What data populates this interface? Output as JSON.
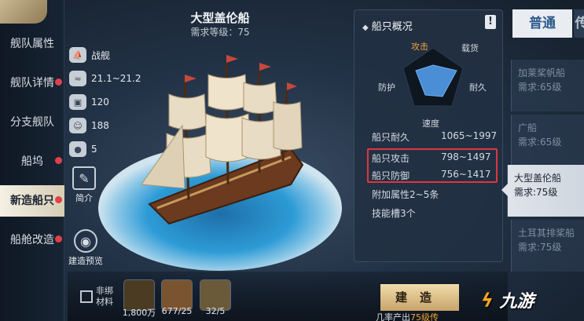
{
  "nav": {
    "items": [
      {
        "label": "舰队属性",
        "dot": false,
        "active": false
      },
      {
        "label": "舰队详情",
        "dot": true,
        "active": false
      },
      {
        "label": "分支舰队",
        "dot": false,
        "active": false
      },
      {
        "label": "船坞",
        "dot": true,
        "active": false
      },
      {
        "label": "新造船只",
        "dot": true,
        "active": true
      },
      {
        "label": "船舱改造",
        "dot": true,
        "active": false
      }
    ]
  },
  "ship": {
    "name": "大型盖伦船",
    "level_label": "需求等级：75",
    "stats": [
      {
        "icon": "ship-type-icon",
        "value": "战舰"
      },
      {
        "icon": "speed-icon",
        "value": "21.1~21.2"
      },
      {
        "icon": "cargo-icon",
        "value": "120"
      },
      {
        "icon": "crew-icon",
        "value": "188"
      },
      {
        "icon": "cannon-icon",
        "value": "5"
      }
    ],
    "intro_label": "简介",
    "preview_label": "建造预览"
  },
  "overview": {
    "title": "船只概况",
    "info_glyph": "!",
    "radar_labels": {
      "attack": "攻击",
      "cargo": "载货",
      "defense": "防护",
      "durability": "耐久",
      "speed": "速度"
    },
    "rows": [
      {
        "label": "船只耐久",
        "value": "1065~1997"
      },
      {
        "label": "船只攻击",
        "value": "798~1497"
      },
      {
        "label": "船只防御",
        "value": "756~1417"
      },
      {
        "label": "附加属性2~5条",
        "value": ""
      },
      {
        "label": "技能槽3个",
        "value": ""
      }
    ],
    "accent": "#e0353f",
    "attack_label_color": "#f0a535"
  },
  "tabs": {
    "active": "普通",
    "inactive": "传"
  },
  "ship_list": [
    {
      "name": "加莱桨帆船",
      "req": "需求:65级",
      "selected": false
    },
    {
      "name": "广船",
      "req": "需求:65级",
      "selected": false
    },
    {
      "name": "大型盖伦船",
      "req": "需求:75级",
      "selected": true
    },
    {
      "name": "土耳其排桨船",
      "req": "需求:75级",
      "selected": false
    }
  ],
  "bottom": {
    "checkbox_label": "非绑材料",
    "materials": [
      {
        "icon": "gold-ingot-icon",
        "count": "1,800万"
      },
      {
        "icon": "wood-plank-icon",
        "count": "677/25"
      },
      {
        "icon": "timber-icon",
        "count": "32/5"
      }
    ],
    "build_label": "建造",
    "hint_prefix": "几率产出",
    "hint_highlight": "75级传"
  },
  "watermark": {
    "text": "九游"
  }
}
